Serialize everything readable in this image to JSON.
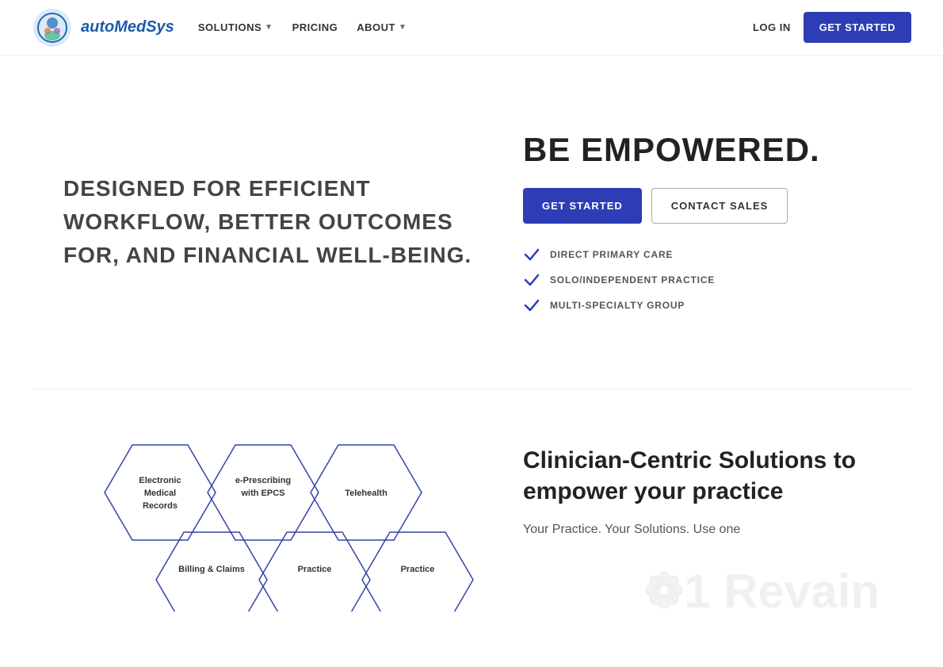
{
  "navbar": {
    "logo_text": "autoMedSys",
    "nav_items": [
      {
        "label": "SOLUTIONS",
        "has_dropdown": true
      },
      {
        "label": "PRICING",
        "has_dropdown": false
      },
      {
        "label": "ABOUT",
        "has_dropdown": true
      }
    ],
    "log_in_label": "LOG IN",
    "get_started_label": "GET STARTED"
  },
  "hero": {
    "heading": "DESIGNED FOR EFFICIENT WORKFLOW, BETTER OUTCOMES FOR, AND FINANCIAL WELL-BEING.",
    "empowered_title": "BE EMPOWERED.",
    "get_started_label": "GET STARTED",
    "contact_sales_label": "CONTACT SALES",
    "checklist": [
      {
        "label": "DIRECT PRIMARY CARE"
      },
      {
        "label": "SOLO/INDEPENDENT PRACTICE"
      },
      {
        "label": "MULTI-SPECIALTY GROUP"
      }
    ]
  },
  "solutions": {
    "title": "Clinician-Centric Solutions to empower your practice",
    "subtitle": "Your Practice. Your Solutions. Use one",
    "hexagons": [
      {
        "label": "Electronic Medical Records"
      },
      {
        "label": "e-Prescribing with EPCS"
      },
      {
        "label": "Telehealth"
      },
      {
        "label": "Billing & Claims"
      },
      {
        "label": "Practice"
      },
      {
        "label": "Practice"
      }
    ]
  },
  "colors": {
    "primary": "#2c3db5",
    "check_color": "#2c3db5",
    "hex_border": "#4455cc"
  }
}
